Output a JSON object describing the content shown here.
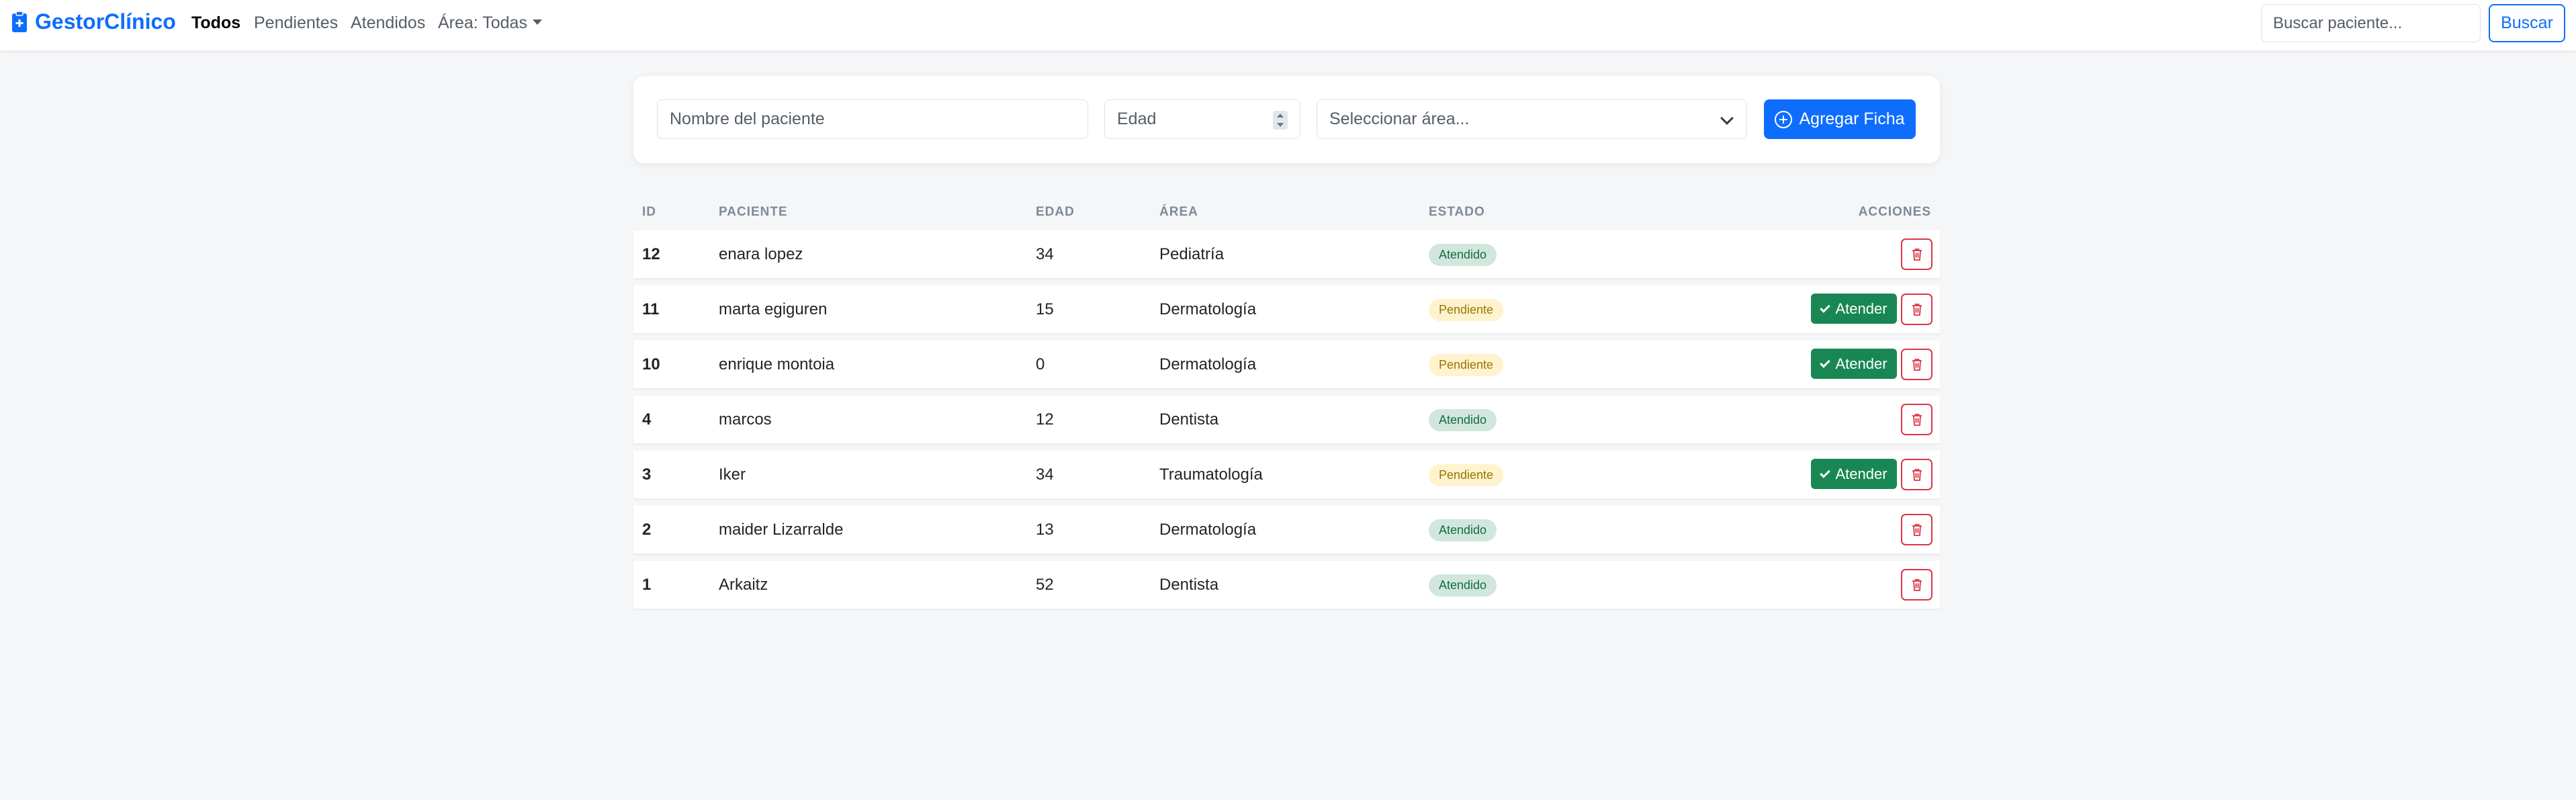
{
  "navbar": {
    "brand": "GestorClínico",
    "links": [
      "Todos",
      "Pendientes",
      "Atendidos"
    ],
    "area_dropdown": "Área: Todas",
    "search_placeholder": "Buscar paciente...",
    "search_button": "Buscar"
  },
  "form": {
    "name_placeholder": "Nombre del paciente",
    "age_placeholder": "Edad",
    "area_placeholder": "Seleccionar área...",
    "add_button": "Agregar Ficha"
  },
  "table": {
    "headers": {
      "id": "ID",
      "paciente": "PACIENTE",
      "edad": "EDAD",
      "area": "ÁREA",
      "estado": "ESTADO",
      "acciones": "ACCIONES"
    },
    "attend_label": "Atender",
    "rows": [
      {
        "id": "12",
        "name": "enara lopez",
        "age": "34",
        "area": "Pediatría",
        "status": "Atendido"
      },
      {
        "id": "11",
        "name": "marta egiguren",
        "age": "15",
        "area": "Dermatología",
        "status": "Pendiente"
      },
      {
        "id": "10",
        "name": "enrique montoia",
        "age": "0",
        "area": "Dermatología",
        "status": "Pendiente"
      },
      {
        "id": "4",
        "name": "marcos",
        "age": "12",
        "area": "Dentista",
        "status": "Atendido"
      },
      {
        "id": "3",
        "name": "Iker",
        "age": "34",
        "area": "Traumatología",
        "status": "Pendiente"
      },
      {
        "id": "2",
        "name": "maider Lizarralde",
        "age": "13",
        "area": "Dermatología",
        "status": "Atendido"
      },
      {
        "id": "1",
        "name": "Arkaitz",
        "age": "52",
        "area": "Dentista",
        "status": "Atendido"
      }
    ]
  },
  "colors": {
    "primary": "#0d6efd",
    "success": "#198754",
    "danger": "#dc3545",
    "background": "#f5f6f8"
  }
}
